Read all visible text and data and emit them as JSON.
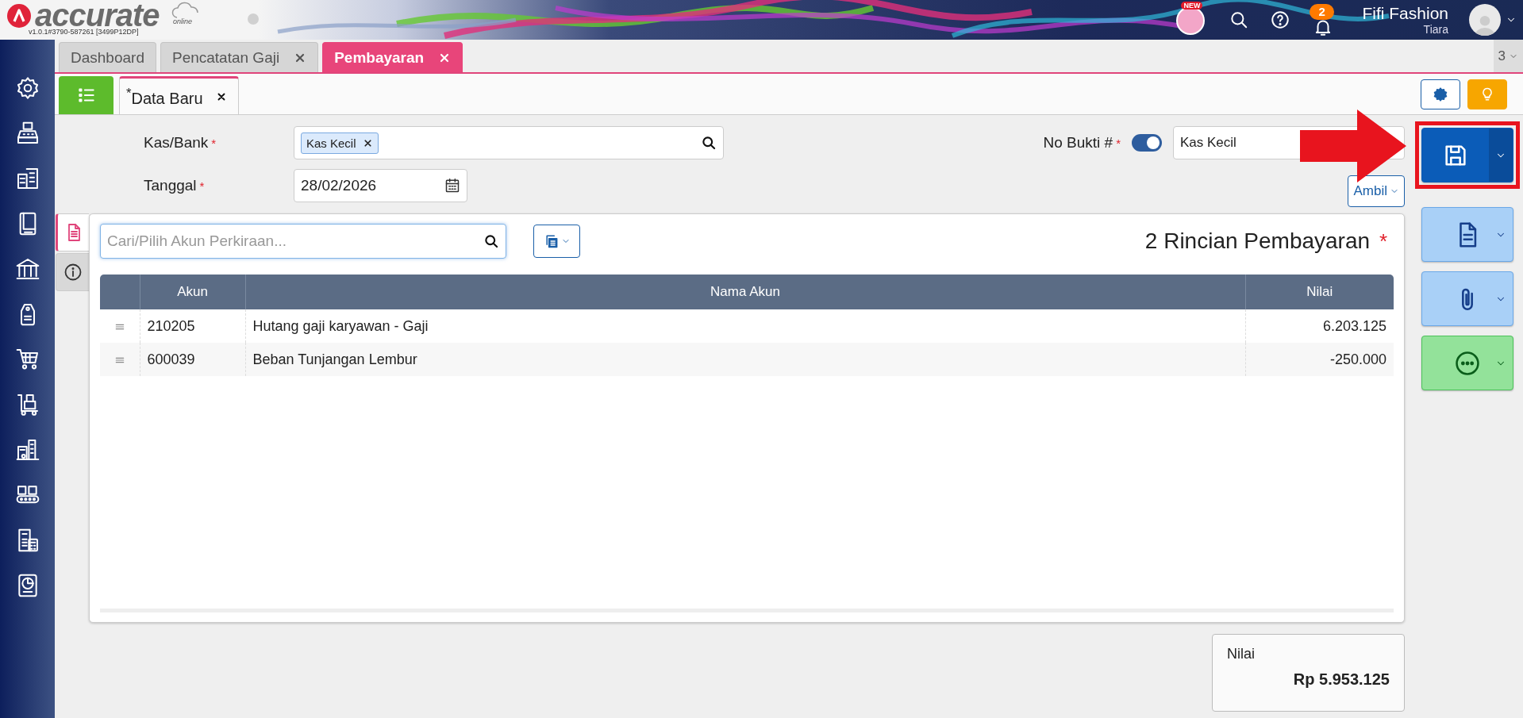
{
  "header": {
    "logo": "accurate",
    "logo_sub": "online",
    "version": "v1.0.1#3790-587261 [3499P12DP]",
    "new_badge": "NEW",
    "notification_count": "2",
    "company": "Fifi Fashion",
    "user": "Tiara"
  },
  "tabs": [
    {
      "label": "Dashboard",
      "closable": false,
      "selected": false
    },
    {
      "label": "Pencatatan Gaji",
      "closable": true,
      "selected": false
    },
    {
      "label": "Pembayaran",
      "closable": true,
      "selected": true
    }
  ],
  "tab_count": "3",
  "subtabs": [
    {
      "label": "$^{*}$Data Baru",
      "selected": true
    }
  ],
  "form": {
    "kas_bank": {
      "label": "Kas/Bank",
      "mark": "*",
      "tags": [
        "Kas Kecil"
      ]
    },
    "tanggal": {
      "label": "Tanggal",
      "mark": "*",
      "value": "28/02/2026"
    },
    "no_bukti": {
      "label": "No Bukti #",
      "mark": "*",
      "auto": true,
      "value": "Kas Kecil"
    },
    "ambil_button": "Ambil"
  },
  "side_tabs": [
    {
      "kind": "detail",
      "selected": true
    },
    {
      "kind": "info",
      "selected": false
    }
  ],
  "detail": {
    "search_placeholder": "Cari/Pilih Akun Perkiraan...",
    "title": "2 Rincian Pembayaran",
    "title_mark": "*",
    "columns": [
      "Akun",
      "Nama Akun",
      "Nilai"
    ],
    "rows": [
      {
        "akun": "210205",
        "nama": "Hutang gaji karyawan - Gaji",
        "nilai": "6.203.125"
      },
      {
        "akun": "600039",
        "nama": "Beban Tunjangan Lembur",
        "nilai": "-250.000"
      }
    ]
  },
  "total": {
    "label": "Nilai",
    "value": "Rp 5.953.125"
  },
  "actions": [
    {
      "kind": "save"
    },
    {
      "kind": "document"
    },
    {
      "kind": "attachment"
    },
    {
      "kind": "more"
    }
  ]
}
